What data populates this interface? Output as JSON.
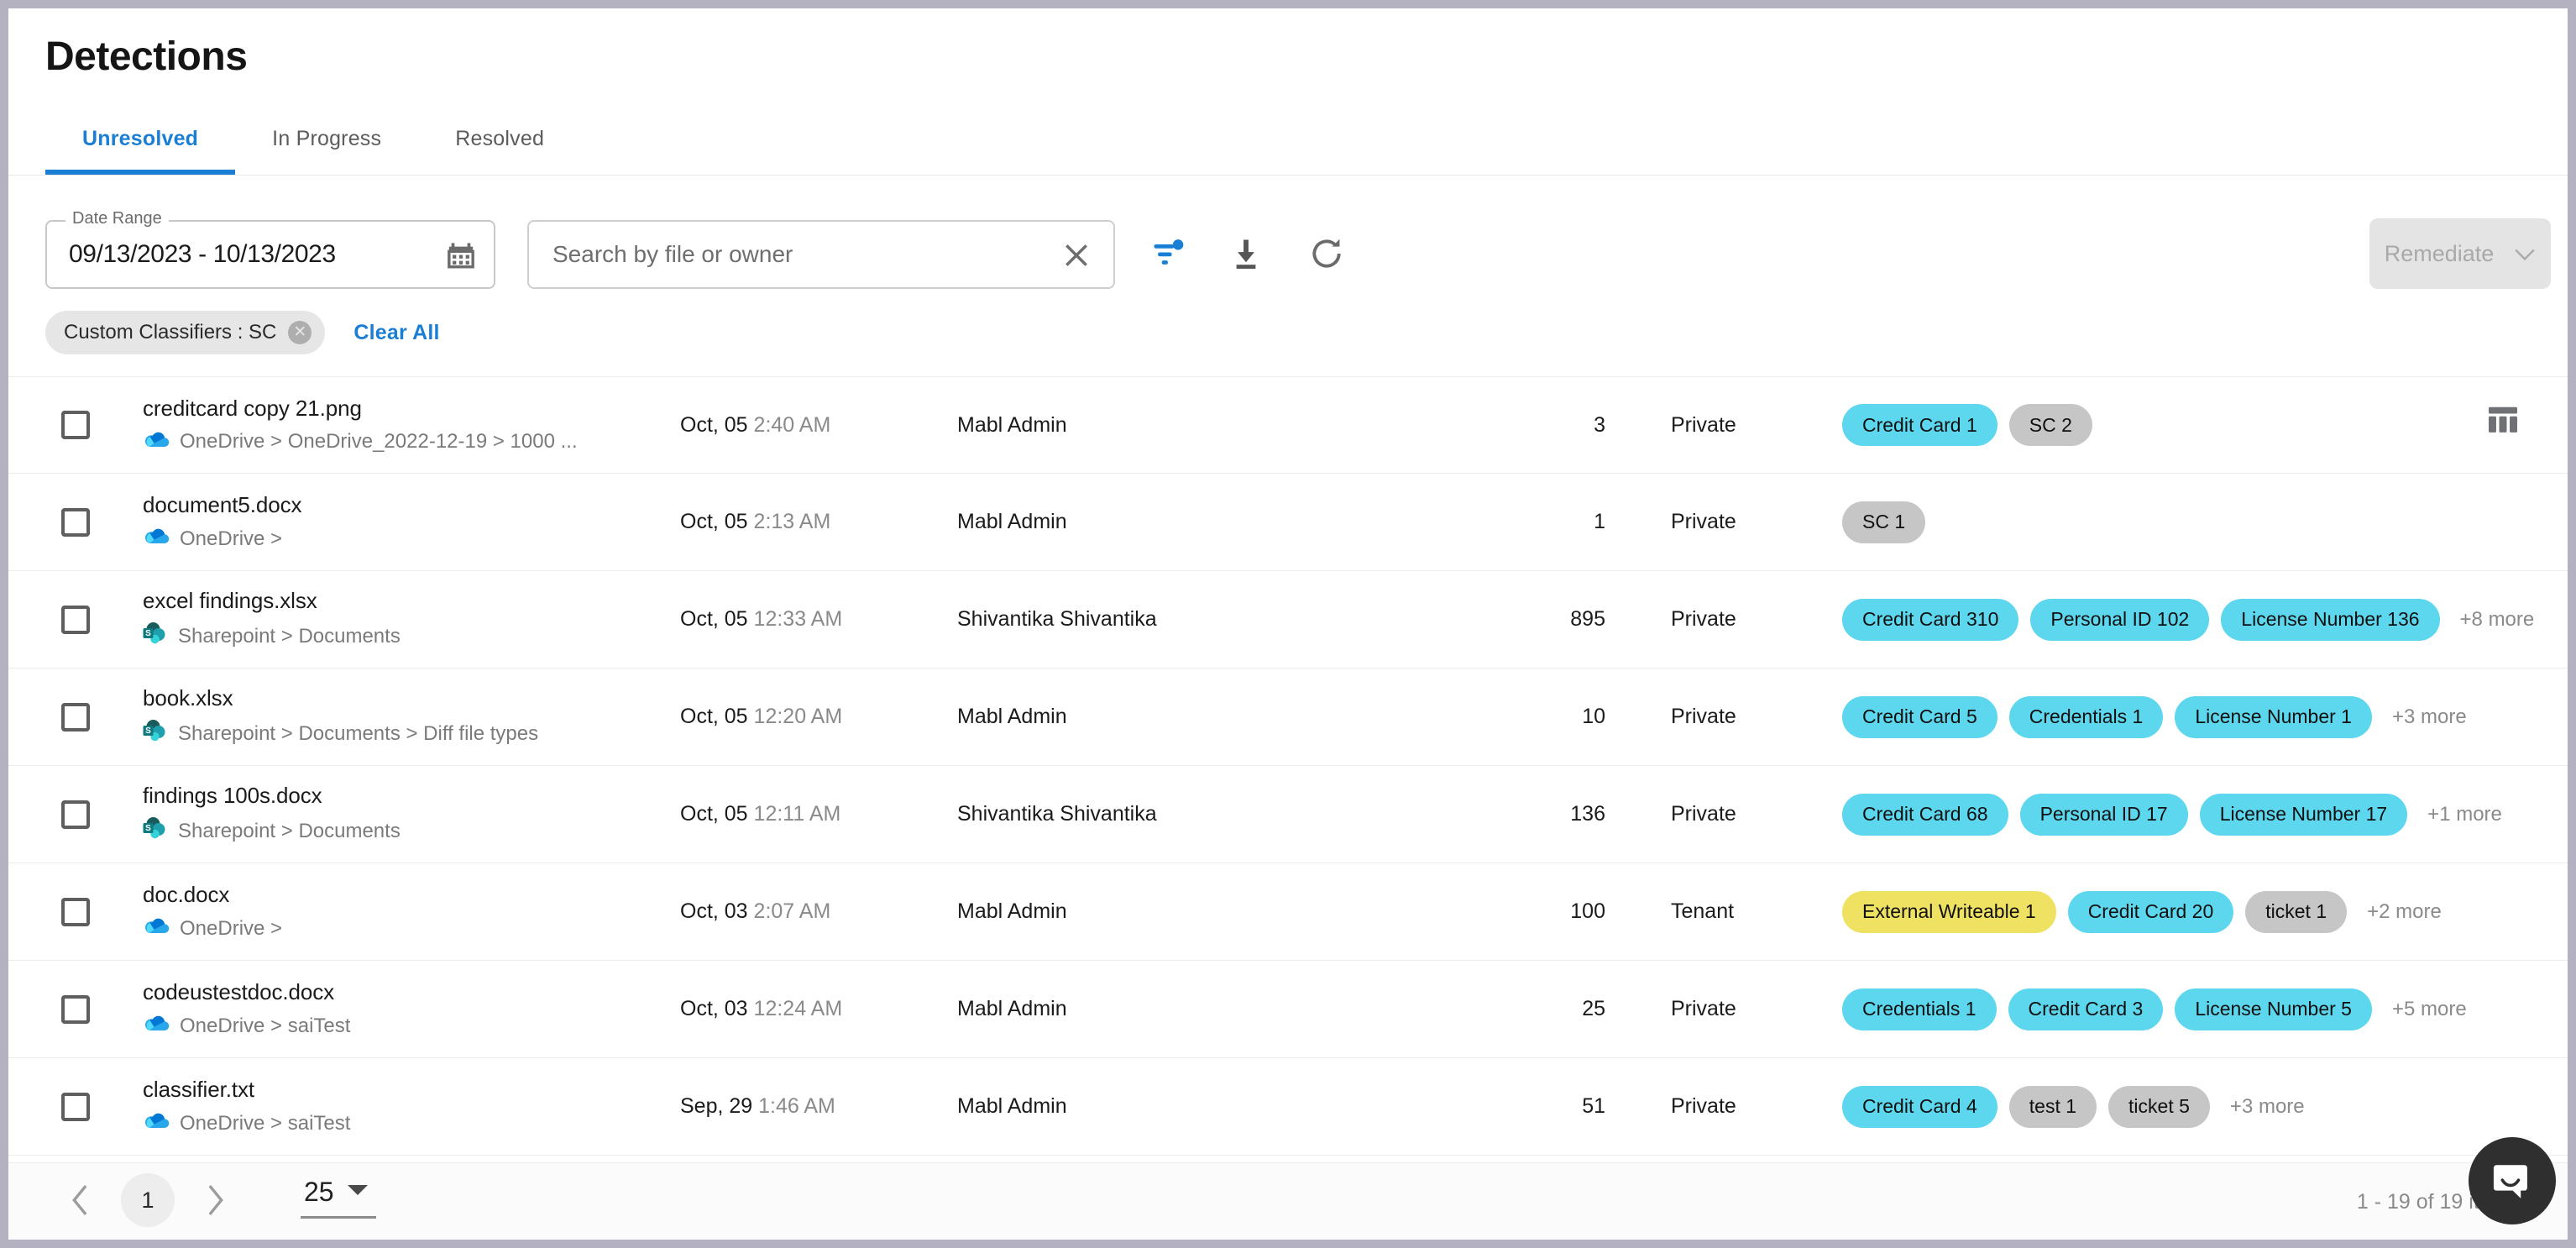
{
  "header": {
    "title": "Detections",
    "tabs": [
      {
        "label": "Unresolved",
        "active": true
      },
      {
        "label": "In Progress",
        "active": false
      },
      {
        "label": "Resolved",
        "active": false
      }
    ]
  },
  "filters": {
    "date_range_label": "Date Range",
    "date_range_value": "09/13/2023 - 10/13/2023",
    "calendar_icon": "calendar-icon",
    "search_placeholder": "Search by file or owner",
    "search_value": "",
    "clear_search_icon": "close-icon",
    "filter_icon": "filter-icon",
    "download_icon": "download-icon",
    "refresh_icon": "refresh-icon",
    "remediate_label": "Remediate",
    "remediate_chevron": "chevron-down-icon",
    "active_chip": "Custom Classifiers : SC",
    "chip_remove_icon": "close-icon",
    "clear_all_label": "Clear All"
  },
  "table": {
    "column_settings_icon": "columns-icon",
    "rows": [
      {
        "file": "creditcard copy 21.png",
        "source_icon": "onedrive-icon",
        "path": "OneDrive > OneDrive_2022-12-19 > 1000 ...",
        "date": "Oct, 05",
        "time": "2:40 AM",
        "owner": "Mabl Admin",
        "count": "3",
        "access": "Private",
        "tags": [
          {
            "label": "Credit Card 1",
            "color": "cyan"
          },
          {
            "label": "SC 2",
            "color": "gray"
          }
        ],
        "more": ""
      },
      {
        "file": "document5.docx",
        "source_icon": "onedrive-icon",
        "path": "OneDrive >",
        "date": "Oct, 05",
        "time": "2:13 AM",
        "owner": "Mabl Admin",
        "count": "1",
        "access": "Private",
        "tags": [
          {
            "label": "SC 1",
            "color": "gray"
          }
        ],
        "more": ""
      },
      {
        "file": "excel findings.xlsx",
        "source_icon": "sharepoint-icon",
        "path": "Sharepoint > Documents",
        "date": "Oct, 05",
        "time": "12:33 AM",
        "owner": "Shivantika Shivantika",
        "count": "895",
        "access": "Private",
        "tags": [
          {
            "label": "Credit Card 310",
            "color": "cyan"
          },
          {
            "label": "Personal ID 102",
            "color": "cyan"
          },
          {
            "label": "License Number 136",
            "color": "cyan"
          }
        ],
        "more": "+8 more"
      },
      {
        "file": "book.xlsx",
        "source_icon": "sharepoint-icon",
        "path": "Sharepoint > Documents > Diff file types",
        "date": "Oct, 05",
        "time": "12:20 AM",
        "owner": "Mabl Admin",
        "count": "10",
        "access": "Private",
        "tags": [
          {
            "label": "Credit Card 5",
            "color": "cyan"
          },
          {
            "label": "Credentials 1",
            "color": "cyan"
          },
          {
            "label": "License Number 1",
            "color": "cyan"
          }
        ],
        "more": "+3 more"
      },
      {
        "file": "findings 100s.docx",
        "source_icon": "sharepoint-icon",
        "path": "Sharepoint > Documents",
        "date": "Oct, 05",
        "time": "12:11 AM",
        "owner": "Shivantika Shivantika",
        "count": "136",
        "access": "Private",
        "tags": [
          {
            "label": "Credit Card 68",
            "color": "cyan"
          },
          {
            "label": "Personal ID 17",
            "color": "cyan"
          },
          {
            "label": "License Number 17",
            "color": "cyan"
          }
        ],
        "more": "+1 more"
      },
      {
        "file": "doc.docx",
        "source_icon": "onedrive-icon",
        "path": "OneDrive >",
        "date": "Oct, 03",
        "time": "2:07 AM",
        "owner": "Mabl Admin",
        "count": "100",
        "access": "Tenant",
        "tags": [
          {
            "label": "External Writeable 1",
            "color": "yellow"
          },
          {
            "label": "Credit Card 20",
            "color": "cyan"
          },
          {
            "label": "ticket 1",
            "color": "gray"
          }
        ],
        "more": "+2 more"
      },
      {
        "file": "codeustestdoc.docx",
        "source_icon": "onedrive-icon",
        "path": "OneDrive > saiTest",
        "date": "Oct, 03",
        "time": "12:24 AM",
        "owner": "Mabl Admin",
        "count": "25",
        "access": "Private",
        "tags": [
          {
            "label": "Credentials 1",
            "color": "cyan"
          },
          {
            "label": "Credit Card 3",
            "color": "cyan"
          },
          {
            "label": "License Number 5",
            "color": "cyan"
          }
        ],
        "more": "+5 more"
      },
      {
        "file": "classifier.txt",
        "source_icon": "onedrive-icon",
        "path": "OneDrive > saiTest",
        "date": "Sep, 29",
        "time": "1:46 AM",
        "owner": "Mabl Admin",
        "count": "51",
        "access": "Private",
        "tags": [
          {
            "label": "Credit Card 4",
            "color": "cyan"
          },
          {
            "label": "test 1",
            "color": "gray"
          },
          {
            "label": "ticket 5",
            "color": "gray"
          }
        ],
        "more": "+3 more"
      }
    ]
  },
  "footer": {
    "prev_icon": "chevron-left-icon",
    "next_icon": "chevron-right-icon",
    "current_page": "1",
    "page_size": "25",
    "page_size_chevron": "caret-down-icon",
    "items_count": "1 - 19 of 19 items",
    "chat_icon": "intercom-chat-icon"
  },
  "colors": {
    "accent": "#1a7fd4",
    "tag_cyan": "#5cd7ee",
    "tag_gray": "#c6c6c6",
    "tag_yellow": "#efe162"
  }
}
